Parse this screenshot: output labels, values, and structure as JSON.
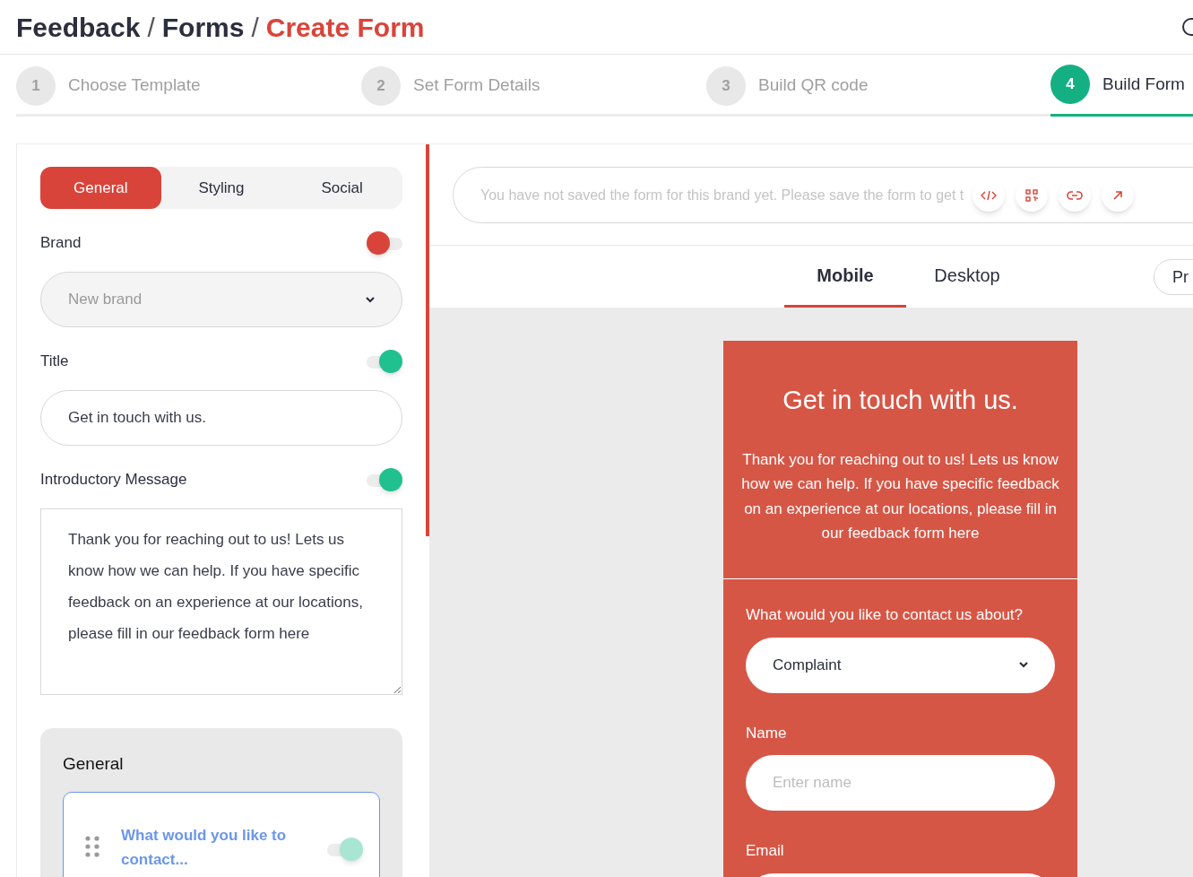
{
  "breadcrumb": [
    {
      "label": "Feedback",
      "current": false
    },
    {
      "label": "Forms",
      "current": false
    },
    {
      "label": "Create Form",
      "current": true
    }
  ],
  "breadcrumb_separator": "/",
  "steps": [
    {
      "number": "1",
      "label": "Choose Template",
      "selected": false
    },
    {
      "number": "2",
      "label": "Set Form Details",
      "selected": false
    },
    {
      "number": "3",
      "label": "Build QR code",
      "selected": false
    },
    {
      "number": "4",
      "label": "Build Form",
      "selected": true
    }
  ],
  "settings_tabs": [
    {
      "label": "General",
      "selected": true
    },
    {
      "label": "Styling",
      "selected": false
    },
    {
      "label": "Social",
      "selected": false
    }
  ],
  "settings": [
    {
      "kind": "select",
      "label": "Brand",
      "on": false,
      "placeholder": "New brand"
    },
    {
      "kind": "input",
      "label": "Title",
      "on": true,
      "value": "Get in touch with us."
    },
    {
      "kind": "textarea",
      "label": "Introductory Message",
      "on": true,
      "value": "Thank you for reaching out to us! Lets us know how we can help. If you have specific feedback on an experience at our locations, please fill in our feedback form here"
    }
  ],
  "section": {
    "title": "General",
    "items": [
      {
        "label": "What would you like to contact...",
        "on": true
      }
    ]
  },
  "notice": {
    "text": "You have not saved the form for this brand yet. Please save the form to get t"
  },
  "view_tabs": [
    {
      "label": "Mobile",
      "selected": true
    },
    {
      "label": "Desktop",
      "selected": false
    }
  ],
  "preview_button": {
    "label": "Pr"
  },
  "preview": {
    "title": "Get in touch with us.",
    "message": "Thank you for reaching out to us! Lets us know how we can help. If you have specific feedback on an experience at our locations, please fill in our feedback form here",
    "fields": [
      {
        "kind": "select",
        "label": "What would you like to contact us about?",
        "value": "Complaint"
      },
      {
        "kind": "input",
        "label": "Name",
        "placeholder": "Enter name"
      },
      {
        "kind": "input",
        "label": "Email"
      }
    ]
  }
}
